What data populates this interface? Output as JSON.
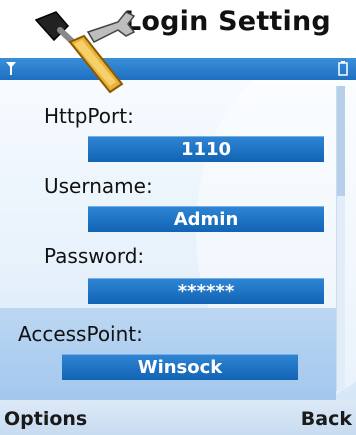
{
  "window": {
    "title": "Login Setting"
  },
  "icons": {
    "app": "tools-wrench-screwdriver-icon",
    "signal": "signal-icon",
    "battery": "battery-icon"
  },
  "fields": [
    {
      "label": "HttpPort:",
      "value": "1110"
    },
    {
      "label": "Username:",
      "value": "Admin"
    },
    {
      "label": "Password:",
      "value": "******"
    },
    {
      "label": "AccessPoint:",
      "value": "Winsock"
    }
  ],
  "softkeys": {
    "left": "Options",
    "right": "Back"
  },
  "colors": {
    "status_bar": "#1e6fc2",
    "field_bg": "#1e74c6",
    "selected_bg": "#b3d1f0"
  }
}
